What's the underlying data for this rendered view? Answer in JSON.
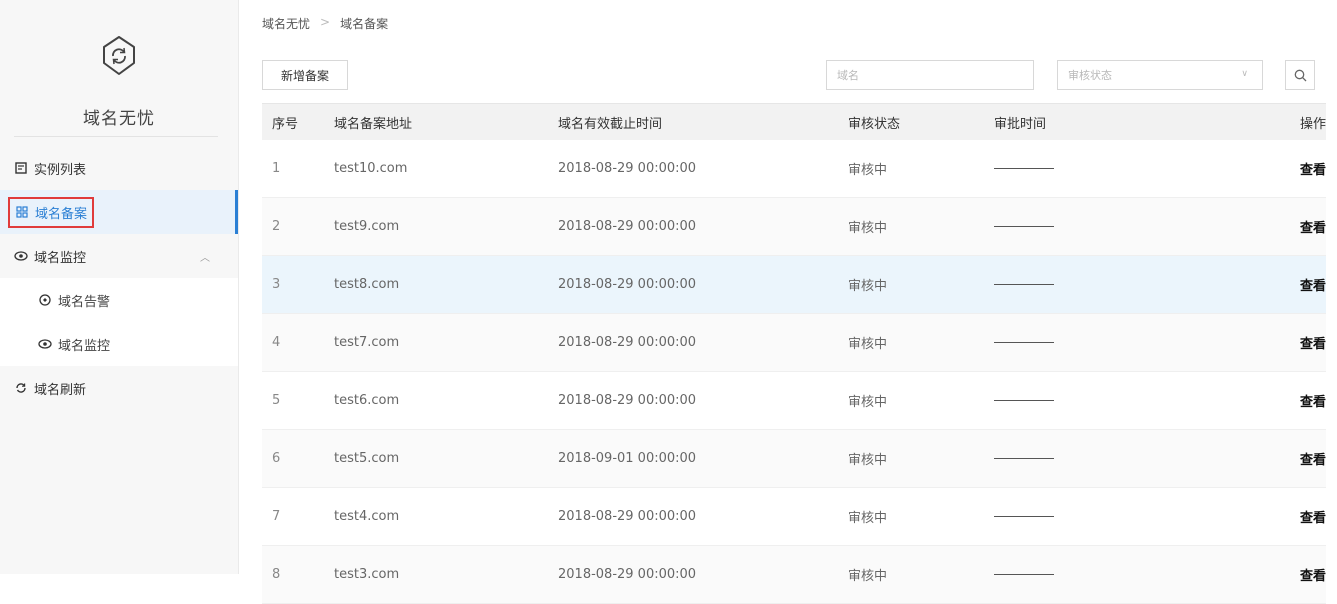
{
  "sidebar": {
    "app_title": "域名无忧",
    "items": [
      {
        "label": "实例列表",
        "icon": "doc-list-icon"
      },
      {
        "label": "域名备案",
        "icon": "grid-icon"
      },
      {
        "label": "域名监控",
        "icon": "eye-icon"
      },
      {
        "label": "域名告警",
        "icon": "alert-icon"
      },
      {
        "label": "域名监控",
        "icon": "eye-icon"
      },
      {
        "label": "域名刷新",
        "icon": "refresh-icon"
      }
    ],
    "active_color": "#2a7fd4",
    "highlight_box_color": "#e03b3b"
  },
  "breadcrumb": {
    "root": "域名无忧",
    "sep": ">",
    "current": "域名备案"
  },
  "toolbar": {
    "add_label": "新增备案",
    "domain_placeholder": "域名",
    "status_placeholder": "审核状态"
  },
  "table": {
    "headers": [
      "序号",
      "域名备案地址",
      "域名有效截止时间",
      "审核状态",
      "审批时间",
      "操作"
    ],
    "rows": [
      {
        "idx": "1",
        "domain": "test10.com",
        "expire": "2018-08-29 00:00:00",
        "status": "审核中",
        "action": "查看"
      },
      {
        "idx": "2",
        "domain": "test9.com",
        "expire": "2018-08-29 00:00:00",
        "status": "审核中",
        "action": "查看"
      },
      {
        "idx": "3",
        "domain": "test8.com",
        "expire": "2018-08-29 00:00:00",
        "status": "审核中",
        "action": "查看"
      },
      {
        "idx": "4",
        "domain": "test7.com",
        "expire": "2018-08-29 00:00:00",
        "status": "审核中",
        "action": "查看"
      },
      {
        "idx": "5",
        "domain": "test6.com",
        "expire": "2018-08-29 00:00:00",
        "status": "审核中",
        "action": "查看"
      },
      {
        "idx": "6",
        "domain": "test5.com",
        "expire": "2018-09-01 00:00:00",
        "status": "审核中",
        "action": "查看"
      },
      {
        "idx": "7",
        "domain": "test4.com",
        "expire": "2018-08-29 00:00:00",
        "status": "审核中",
        "action": "查看"
      },
      {
        "idx": "8",
        "domain": "test3.com",
        "expire": "2018-08-29 00:00:00",
        "status": "审核中",
        "action": "查看"
      }
    ]
  }
}
